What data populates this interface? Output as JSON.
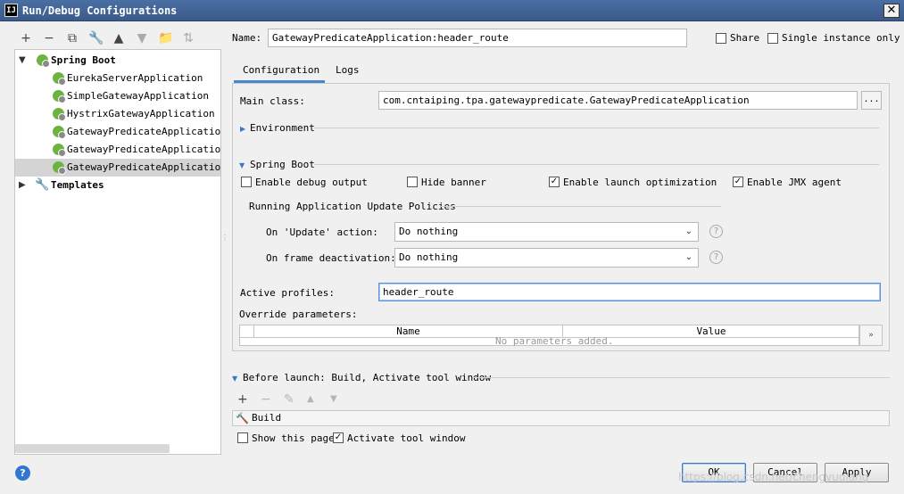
{
  "window": {
    "title": "Run/Debug Configurations",
    "icon_text": "IJ",
    "close_label": "✕"
  },
  "left_toolbar": {
    "icons": [
      "plus-icon",
      "minus-icon",
      "copy-icon",
      "wrench-icon",
      "arrow-up-icon",
      "arrow-down-icon",
      "folder-icon",
      "sort-icon"
    ]
  },
  "tree": {
    "root": {
      "label": "Spring Boot",
      "expanded": true
    },
    "items": [
      {
        "label": "EurekaServerApplication"
      },
      {
        "label": "SimpleGatewayApplication"
      },
      {
        "label": "HystrixGatewayApplication"
      },
      {
        "label": "GatewayPredicateApplication:s"
      },
      {
        "label": "GatewayPredicateApplication:b"
      },
      {
        "label": "GatewayPredicateApplication:h",
        "selected": true
      }
    ],
    "templates": {
      "label": "Templates",
      "expanded": false
    }
  },
  "name_field": {
    "label": "Name:",
    "value": "GatewayPredicateApplication:header_route"
  },
  "share": {
    "label": "Share",
    "checked": false
  },
  "single_instance": {
    "label": "Single instance only",
    "checked": false
  },
  "tabs": [
    {
      "label": "Configuration",
      "active": true
    },
    {
      "label": "Logs",
      "active": false
    }
  ],
  "main_class": {
    "label": "Main class:",
    "value": "com.cntaiping.tpa.gatewaypredicate.GatewayPredicateApplication",
    "browse_label": "..."
  },
  "environment": {
    "label": "Environment"
  },
  "spring_boot_section": {
    "label": "Spring Boot",
    "options": [
      {
        "label": "Enable debug output",
        "checked": false
      },
      {
        "label": "Hide banner",
        "checked": false
      },
      {
        "label": "Enable launch optimization",
        "checked": true
      },
      {
        "label": "Enable JMX agent",
        "checked": true
      }
    ],
    "policies_title": "Running Application Update Policies",
    "update_action": {
      "label": "On 'Update' action:",
      "value": "Do nothing"
    },
    "frame_deactivation": {
      "label": "On frame deactivation:",
      "value": "Do nothing"
    }
  },
  "active_profiles": {
    "label": "Active profiles:",
    "value": "header_route"
  },
  "override_parameters": {
    "label": "Override parameters:",
    "columns": [
      "Name",
      "Value"
    ],
    "empty_text": "No parameters added.",
    "expand_label": "»"
  },
  "before_launch": {
    "label": "Before launch: Build, Activate tool window",
    "items": [
      {
        "label": "Build"
      }
    ],
    "show_page": {
      "label": "Show this page",
      "checked": false
    },
    "activate_tool_window": {
      "label": "Activate tool window",
      "checked": true
    }
  },
  "buttons": {
    "ok": "OK",
    "cancel": "Cancel",
    "apply": "Apply"
  },
  "watermark": "https://blog.csdn.net/chengyuqiang"
}
